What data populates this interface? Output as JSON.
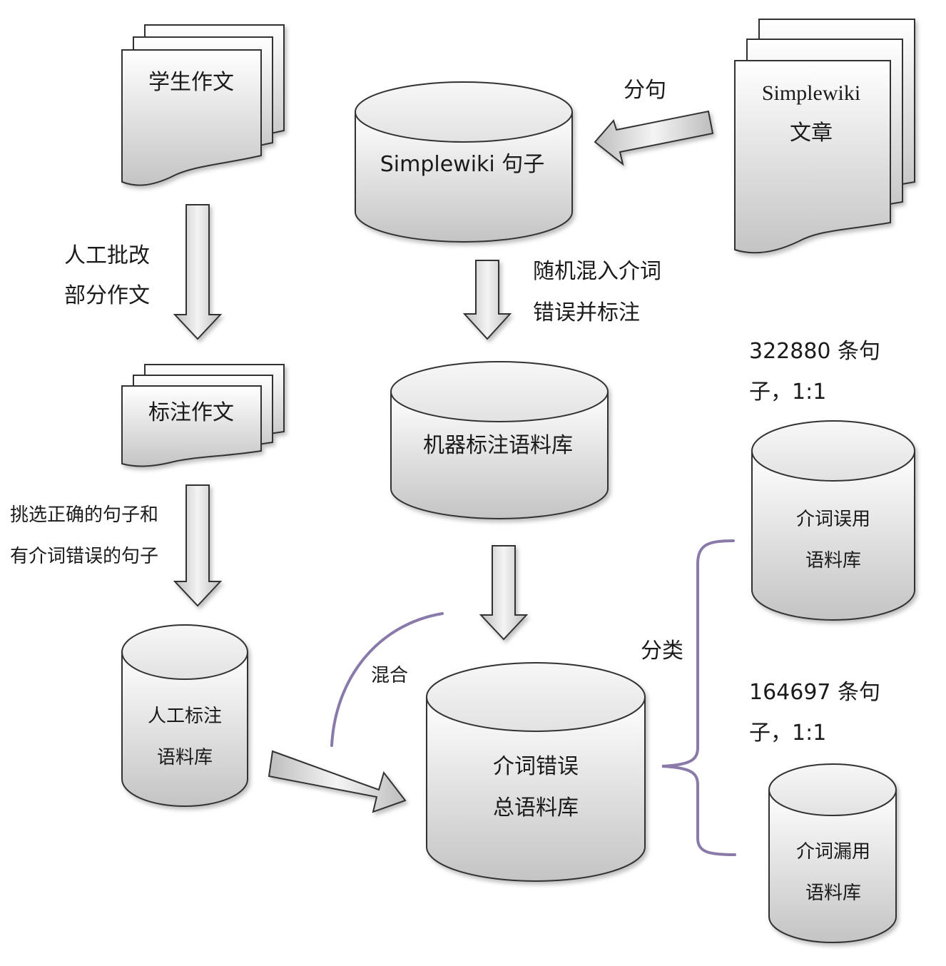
{
  "documents": {
    "student_essays": "学生作文",
    "annotated_essays": "标注作文",
    "simplewiki_articles": [
      "Simplewiki",
      "文章"
    ]
  },
  "databases": {
    "simplewiki_sentences": "Simplewiki 句子",
    "machine_corpus": "机器标注语料库",
    "manual_corpus": [
      "人工标注",
      "语料库"
    ],
    "total_corpus": [
      "介词错误",
      "总语料库"
    ],
    "misuse_corpus": [
      "介词误用",
      "语料库"
    ],
    "omission_corpus": [
      "介词漏用",
      "语料库"
    ]
  },
  "edge_labels": {
    "split_sentences": "分句",
    "manual_correction": [
      "人工批改",
      "部分作文"
    ],
    "random_insert": [
      "随机混入介词",
      "错误并标注"
    ],
    "select_sentences": [
      "挑选正确的句子和",
      "有介词错误的句子"
    ],
    "mix": "混合",
    "classify": "分类"
  },
  "counts": {
    "misuse": [
      "322880 条句",
      "子，1:1"
    ],
    "omission": [
      "164697 条句",
      "子，1:1"
    ]
  },
  "colors": {
    "shape_fill_top": "#ffffff",
    "shape_fill_bottom": "#c8c8c8",
    "stroke": "#333333",
    "bracket": "#8a7aaa"
  }
}
